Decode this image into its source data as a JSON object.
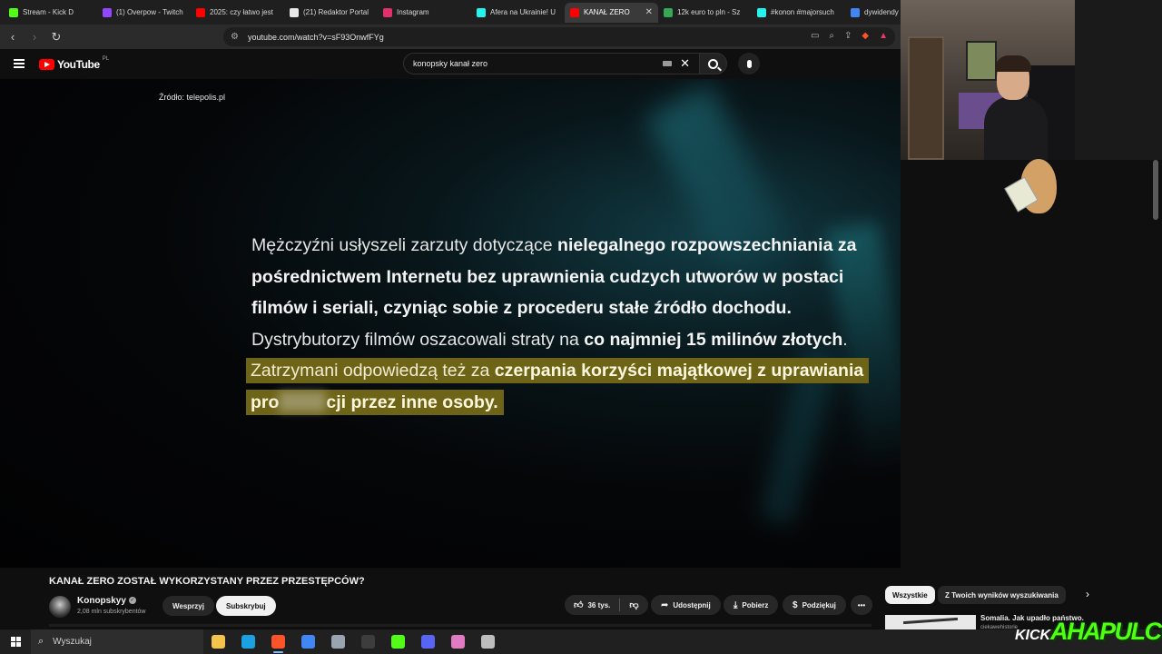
{
  "browser": {
    "tabs": [
      {
        "title": "Stream - Kick D",
        "color": "#53fc18",
        "active": false
      },
      {
        "title": "(1) Overpow - Twitch",
        "color": "#9146ff",
        "active": false
      },
      {
        "title": "2025: czy łatwo jest",
        "color": "#ff0000",
        "active": false
      },
      {
        "title": "(21) Redaktor Portal",
        "color": "#e7e7e7",
        "active": false
      },
      {
        "title": "Instagram",
        "color": "#e1306c",
        "active": false
      },
      {
        "title": "Afera na Ukrainie! U",
        "color": "#25f4ee",
        "active": false
      },
      {
        "title": "KANAŁ ZERO",
        "color": "#ff0000",
        "active": true
      },
      {
        "title": "12k euro to pln - Sz",
        "color": "#34a853",
        "active": false
      },
      {
        "title": "#konon #majorsuch",
        "color": "#25f4ee",
        "active": false
      },
      {
        "title": "dywidendy",
        "color": "#4285f4",
        "active": false
      }
    ],
    "url": "youtube.com/watch?v=sF93OnwfFYg"
  },
  "youtube": {
    "logo_word": "YouTube",
    "logo_country": "PL",
    "search_query": "konopsky kanał zero"
  },
  "video": {
    "source_note": "Źródło: telepolis.pl",
    "lines": {
      "l1_a": "Mężczyźni usłyszeli zarzuty dotyczące ",
      "l1_b": "nielegalnego rozpowszechniania za",
      "l2_b": "pośrednictwem Internetu bez uprawnienia cudzych utworów w postaci",
      "l3_b": "filmów i seriali, czyniąc sobie z procederu stałe źródło dochodu.",
      "l4_a": "Dystrybutorzy filmów oszacowali straty na ",
      "l4_b": "co najmniej 15 milinów złotych",
      "l4_c": ".",
      "l5_a": "Zatrzymani odpowiedzą też za ",
      "l5_b": "czerpania korzyści majątkowej z uprawiania",
      "l6_b1": "pro",
      "l6_b2": "cji przez inne osoby."
    }
  },
  "below": {
    "title": "KANAŁ ZERO ZOSTAŁ WYKORZYSTANY PRZEZ PRZESTĘPCÓW?",
    "channel_name": "Konopskyy",
    "subscribers": "2,08 mln subskrybentów",
    "support_label": "Wesprzyj",
    "subscribe_label": "Subskrybuj",
    "likes": "36 tys.",
    "share_label": "Udostępnij",
    "download_label": "Pobierz",
    "thanks_label": "Podziękuj",
    "more_label": "•••"
  },
  "chips": {
    "all": "Wszystkie",
    "from_search": "Z Twoich wyników wyszukiwania"
  },
  "recommended": {
    "title": "Somalia. Jak upadło państwo.",
    "channel": "ciekawehistorie"
  },
  "watermark": {
    "kick": "KICK",
    "name": "AHAPULCO"
  },
  "taskbar": {
    "search_placeholder": "Wyszukaj",
    "apps": [
      {
        "name": "file-explorer-icon",
        "color": "#f3c34b"
      },
      {
        "name": "edge-icon",
        "color": "#1ba1e2"
      },
      {
        "name": "brave-icon",
        "color": "#fb542b",
        "active": true
      },
      {
        "name": "chrome-icon",
        "color": "#4285f4"
      },
      {
        "name": "notepad-icon",
        "color": "#9aa4b0"
      },
      {
        "name": "obs-icon",
        "color": "#3d3d3d"
      },
      {
        "name": "kick-app-icon",
        "color": "#53fc18"
      },
      {
        "name": "discord-icon",
        "color": "#5865f2"
      },
      {
        "name": "chat-app-icon",
        "color": "#e07ac2"
      },
      {
        "name": "settings-app-icon",
        "color": "#bdbdbd"
      }
    ]
  }
}
